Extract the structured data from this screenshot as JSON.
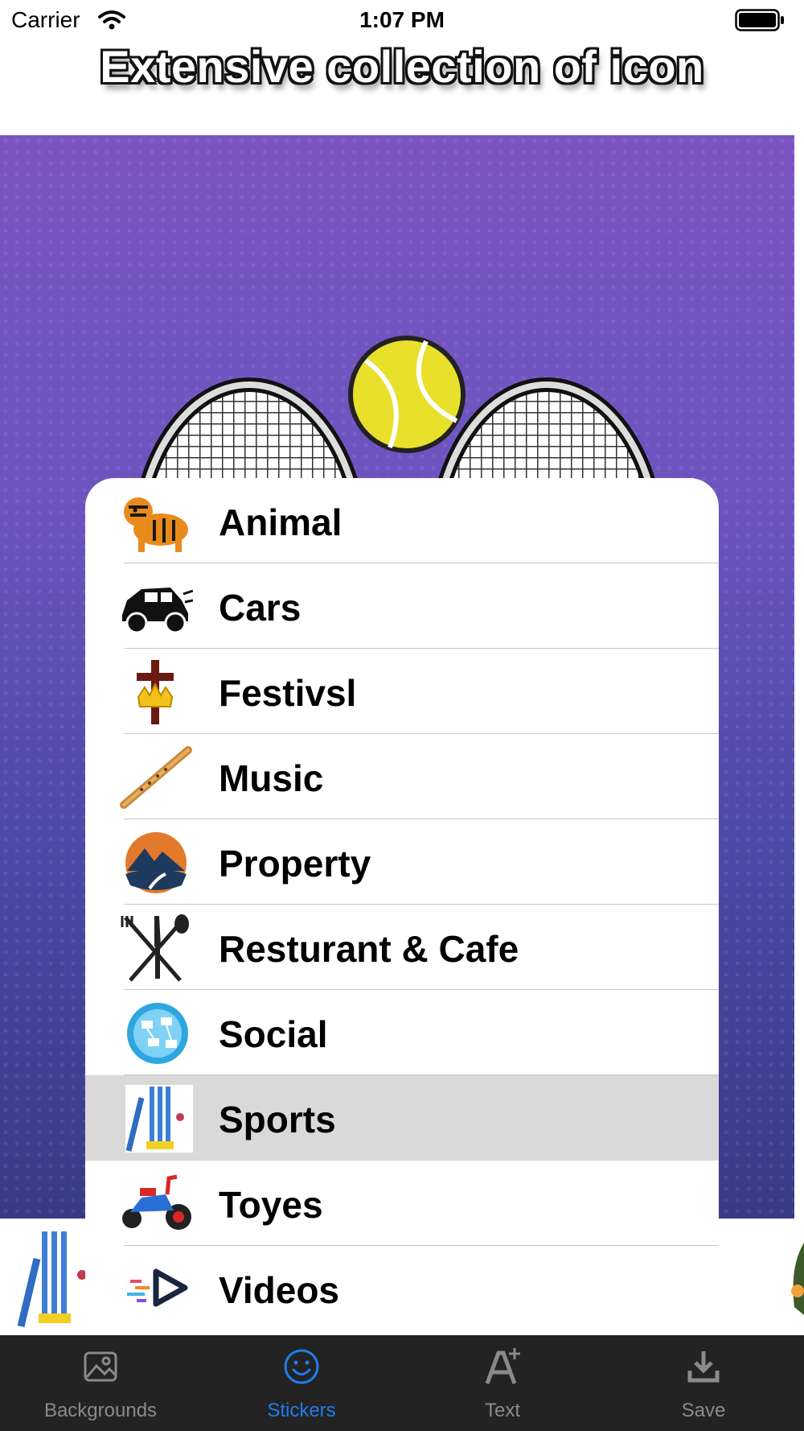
{
  "status_bar": {
    "carrier": "Carrier",
    "time": "1:07 PM"
  },
  "headline": "Extensive collection of icon",
  "menu": {
    "items": [
      {
        "label": "Animal",
        "icon": "tiger-icon",
        "selected": false
      },
      {
        "label": "Cars",
        "icon": "jeep-icon",
        "selected": false
      },
      {
        "label": "Festivsl",
        "icon": "cross-crown-icon",
        "selected": false
      },
      {
        "label": "Music",
        "icon": "flute-icon",
        "selected": false
      },
      {
        "label": "Property",
        "icon": "mountain-logo-icon",
        "selected": false
      },
      {
        "label": "Resturant & Cafe",
        "icon": "cutlery-icon",
        "selected": false
      },
      {
        "label": "Social",
        "icon": "globe-network-icon",
        "selected": false
      },
      {
        "label": "Sports",
        "icon": "cricket-icon",
        "selected": true
      },
      {
        "label": "Toyes",
        "icon": "tricycle-icon",
        "selected": false
      },
      {
        "label": "Videos",
        "icon": "video-play-icon",
        "selected": false
      }
    ]
  },
  "tabs": [
    {
      "label": "Backgrounds",
      "icon": "image-icon",
      "active": false
    },
    {
      "label": "Stickers",
      "icon": "smiley-icon",
      "active": true
    },
    {
      "label": "Text",
      "icon": "text-add-icon",
      "active": false
    },
    {
      "label": "Save",
      "icon": "download-icon",
      "active": false
    }
  ],
  "colors": {
    "tab_active": "#1f7cf0",
    "tab_inactive": "#8a8a8a",
    "tabbar_bg": "#232323",
    "selected_row": "#d9d9d9"
  }
}
